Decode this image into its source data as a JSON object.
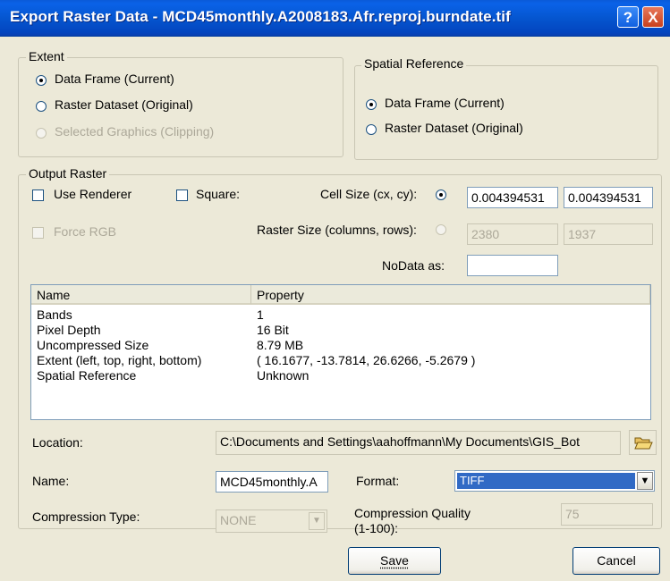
{
  "window": {
    "title": "Export Raster Data - MCD45monthly.A2008183.Afr.reproj.burndate.tif",
    "help_label": "?",
    "close_label": "X"
  },
  "extent": {
    "label": "Extent",
    "options": [
      {
        "label": "Data Frame (Current)",
        "selected": true,
        "enabled": true
      },
      {
        "label": "Raster Dataset (Original)",
        "selected": false,
        "enabled": true
      },
      {
        "label": "Selected Graphics (Clipping)",
        "selected": false,
        "enabled": false
      }
    ]
  },
  "spatial_reference": {
    "label": "Spatial Reference",
    "options": [
      {
        "label": "Data Frame (Current)",
        "selected": true
      },
      {
        "label": "Raster Dataset (Original)",
        "selected": false
      }
    ]
  },
  "output_raster": {
    "label": "Output Raster",
    "use_renderer_label": "Use Renderer",
    "square_label": "Square:",
    "force_rgb_label": "Force RGB",
    "cell_size_label": "Cell Size (cx, cy):",
    "cell_size_x": "0.004394531",
    "cell_size_y": "0.004394531",
    "raster_size_label": "Raster Size (columns, rows):",
    "raster_columns": "2380",
    "raster_rows": "1937",
    "nodata_label": "NoData as:",
    "nodata_value": ""
  },
  "properties": {
    "columns": [
      "Name",
      "Property"
    ],
    "rows": [
      [
        "Bands",
        "1"
      ],
      [
        "Pixel Depth",
        "16 Bit"
      ],
      [
        "Uncompressed Size",
        "8.79 MB"
      ],
      [
        "Extent (left, top, right, bottom)",
        "( 16.1677, -13.7814, 26.6266, -5.2679 )"
      ],
      [
        "Spatial Reference",
        "Unknown"
      ]
    ]
  },
  "location": {
    "label": "Location:",
    "value": "C:\\Documents and Settings\\aahoffmann\\My Documents\\GIS_Bot"
  },
  "name": {
    "label": "Name:",
    "value": "MCD45monthly.A"
  },
  "format": {
    "label": "Format:",
    "value": "TIFF"
  },
  "compression": {
    "type_label": "Compression Type:",
    "type_value": "NONE",
    "quality_label_line1": "Compression Quality",
    "quality_label_line2": "(1-100):",
    "quality_value": "75"
  },
  "buttons": {
    "save": "Save",
    "cancel": "Cancel"
  }
}
